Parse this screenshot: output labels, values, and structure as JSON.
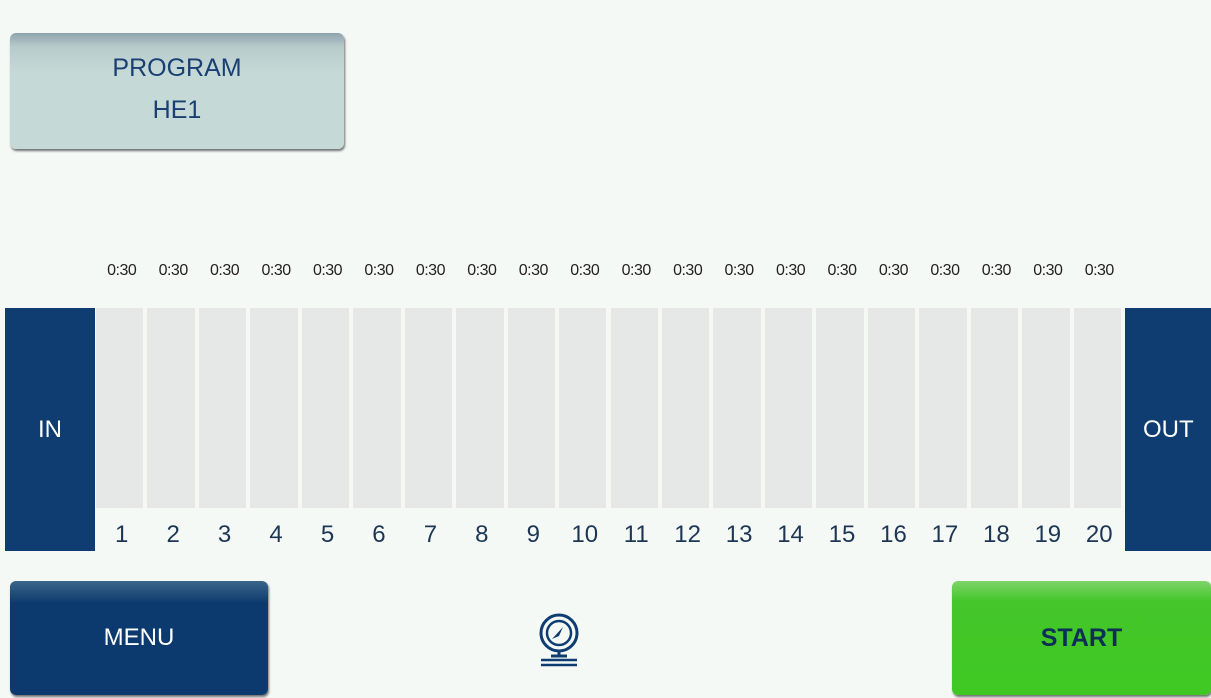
{
  "program": {
    "label": "PROGRAM",
    "value": "HE1"
  },
  "station_times": [
    "0:30",
    "0:30",
    "0:30",
    "0:30",
    "0:30",
    "0:30",
    "0:30",
    "0:30",
    "0:30",
    "0:30",
    "0:30",
    "0:30",
    "0:30",
    "0:30",
    "0:30",
    "0:30",
    "0:30",
    "0:30",
    "0:30",
    "0:30"
  ],
  "station_numbers": [
    "1",
    "2",
    "3",
    "4",
    "5",
    "6",
    "7",
    "8",
    "9",
    "10",
    "11",
    "12",
    "13",
    "14",
    "15",
    "16",
    "17",
    "18",
    "19",
    "20"
  ],
  "in_label": "IN",
  "out_label": "OUT",
  "menu_label": "MENU",
  "start_label": "START",
  "icons": {
    "gauge": "pressure-gauge-icon"
  },
  "colors": {
    "accent_dark_blue": "#0f3d71",
    "start_green": "#3fc823",
    "program_button": "#c5d9d6",
    "cell_gray": "#e6e8e7"
  }
}
